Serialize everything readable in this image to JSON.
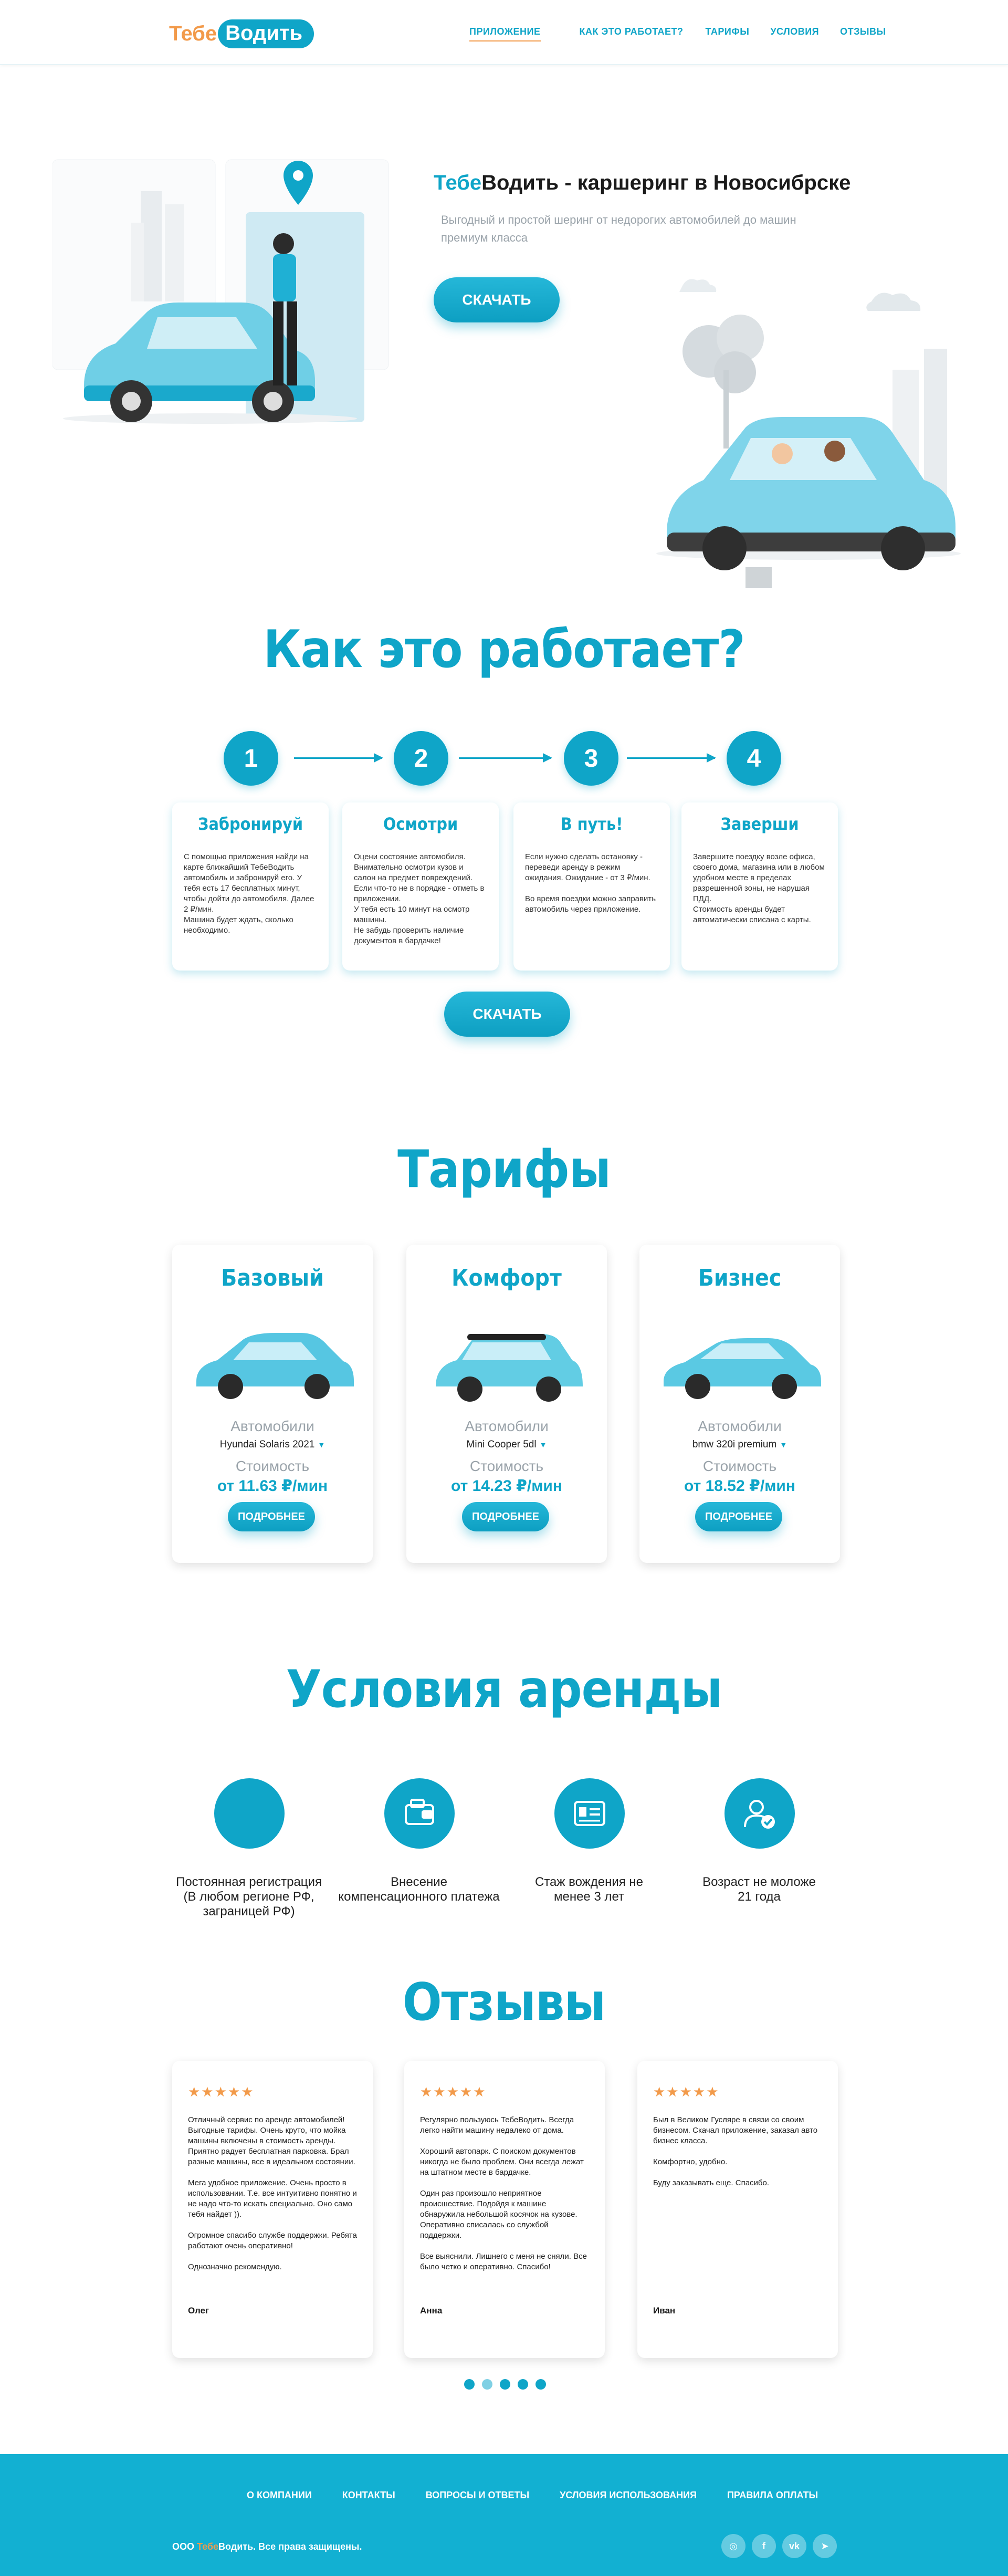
{
  "header": {
    "logo": {
      "part1": "Тебе",
      "part2": "Водить"
    },
    "nav": [
      {
        "label": "ПРИЛОЖЕНИЕ",
        "active": true
      },
      {
        "label": "КАК ЭТО РАБОТАЕТ?",
        "active": false
      },
      {
        "label": "ТАРИФЫ",
        "active": false
      },
      {
        "label": "УСЛОВИЯ",
        "active": false
      },
      {
        "label": "ОТЗЫВЫ",
        "active": false
      }
    ]
  },
  "hero": {
    "title_brand_a": "Тебе",
    "title_brand_b": "Водить",
    "title_rest": "  - каршеринг в Новосибрске",
    "subtitle": "Выгодный и простой шеринг от недорогих автомобилей до машин премиум класса",
    "button": "СКАЧАТЬ"
  },
  "how": {
    "title": "Как это работает?",
    "steps": [
      {
        "num": "1",
        "title": "Забронируй",
        "text": "С помощью приложения найди на карте ближайший ТебеВодить автомобиль и забронируй его. У тебя есть 17 бесплатных минут, чтобы дойти до автомобиля. Далее 2 ₽/мин.\nМашина будет ждать, сколько необходимо."
      },
      {
        "num": "2",
        "title": "Осмотри",
        "text": "Оцени состояние автомобиля. Внимательно осмотри кузов и салон на предмет повреждений. Если что-то не в порядке - отметь в приложении.\nУ тебя есть 10 минут на осмотр машины.\nНе забудь проверить наличие документов в бардачке!"
      },
      {
        "num": "3",
        "title": "В путь!",
        "text": "Если нужно сделать остановку - переведи аренду в режим ожидания. Ожидание - от 3 ₽/мин.\n\nВо время поездки можно заправить автомобиль через приложение."
      },
      {
        "num": "4",
        "title": "Заверши",
        "text": "Завершите поездку возле офиса, своего дома, магазина или в любом удобном месте в пределах разрешенной зоны, не нарушая ПДД.\nСтоимость аренды будет автоматически списана с карты."
      }
    ],
    "button": "СКАЧАТЬ"
  },
  "tariffs": {
    "title": "Тарифы",
    "cars_label": "Автомобили",
    "cost_label": "Стоимость",
    "button": "ПОДРОБНЕЕ",
    "items": [
      {
        "name": "Базовый",
        "model": "Hyundai Solaris 2021",
        "price": "от 11.63 ₽/мин",
        "car_color": "#56c6e2"
      },
      {
        "name": "Комфорт",
        "model": "Mini Cooper 5dl",
        "price": "от 14.23 ₽/мин",
        "car_color": "#62cde4"
      },
      {
        "name": "Бизнес",
        "model": "bmw 320i premium",
        "price": "от 18.52 ₽/мин",
        "car_color": "#5ac9e3"
      }
    ]
  },
  "conditions": {
    "title": "Условия аренды",
    "items": [
      {
        "text": "Постоянная регистрация\n(В любом регионе РФ,\nзаграницей РФ)",
        "icon": "passport-icon"
      },
      {
        "text": "Внесение\nкомпенсационного платежа",
        "icon": "wallet-icon"
      },
      {
        "text": "Стаж вождения не\nменее 3 лет",
        "icon": "license-icon"
      },
      {
        "text": "Возраст не моложе\n21 года",
        "icon": "person-check-icon"
      }
    ]
  },
  "reviews": {
    "title": "Отзывы",
    "stars": "★★★★★",
    "items": [
      {
        "text": "Отличный сервис по аренде автомобилей! Выгодные тарифы. Очень круто, что мойка машины включены в стоимость аренды. Приятно радует бесплатная парковка. Брал разные машины, все в идеальном состоянии.\n\nМега удобное приложение. Очень просто в использовании. Т.е. все интуитивно понятно и не надо что-то искать специально. Оно само тебя найдет )).\n\nОгромное спасибо службе поддержки. Ребята работают очень оперативно!\n\nОднозначно рекомендую.",
        "name": "Олег"
      },
      {
        "text": "Регулярно пользуюсь ТебеВодить. Всегда легко найти машину недалеко от дома.\n\nХороший автопарк. С поиском документов никогда не было проблем. Они всегда лежат на штатном месте в бардачке.\n\nОдин раз произошло неприятное происшествие. Подойдя к машине обнаружила небольшой косячок на кузове. Оперативно списалась со службой поддержки.\n\nВсе выяснили. Лишнего с меня не сняли. Все было четко и оперативно. Спасибо!",
        "name": "Анна"
      },
      {
        "text": "Был в Великом Гусляре в связи со своим бизнесом. Скачал приложение, заказал авто бизнес класса.\n\nКомфортно, удобно.\n\nБуду заказывать еще. Спасибо.",
        "name": "Иван"
      }
    ]
  },
  "footer": {
    "nav": [
      "О КОМПАНИИ",
      "КОНТАКТЫ",
      "ВОПРОСЫ И ОТВЕТЫ",
      "УСЛОВИЯ ИСПОЛЬЗОВАНИЯ",
      "ПРАВИЛА ОПЛАТЫ"
    ],
    "copy_prefix": "ООО ",
    "copy_brand_a": "Тебе",
    "copy_brand_b": "Водить",
    "copy_suffix": ". Все права защищены.",
    "social": [
      {
        "icon": "instagram-icon",
        "glyph": "◎"
      },
      {
        "icon": "facebook-icon",
        "glyph": "f"
      },
      {
        "icon": "vk-icon",
        "glyph": "vk"
      },
      {
        "icon": "telegram-icon",
        "glyph": "➤"
      }
    ]
  }
}
